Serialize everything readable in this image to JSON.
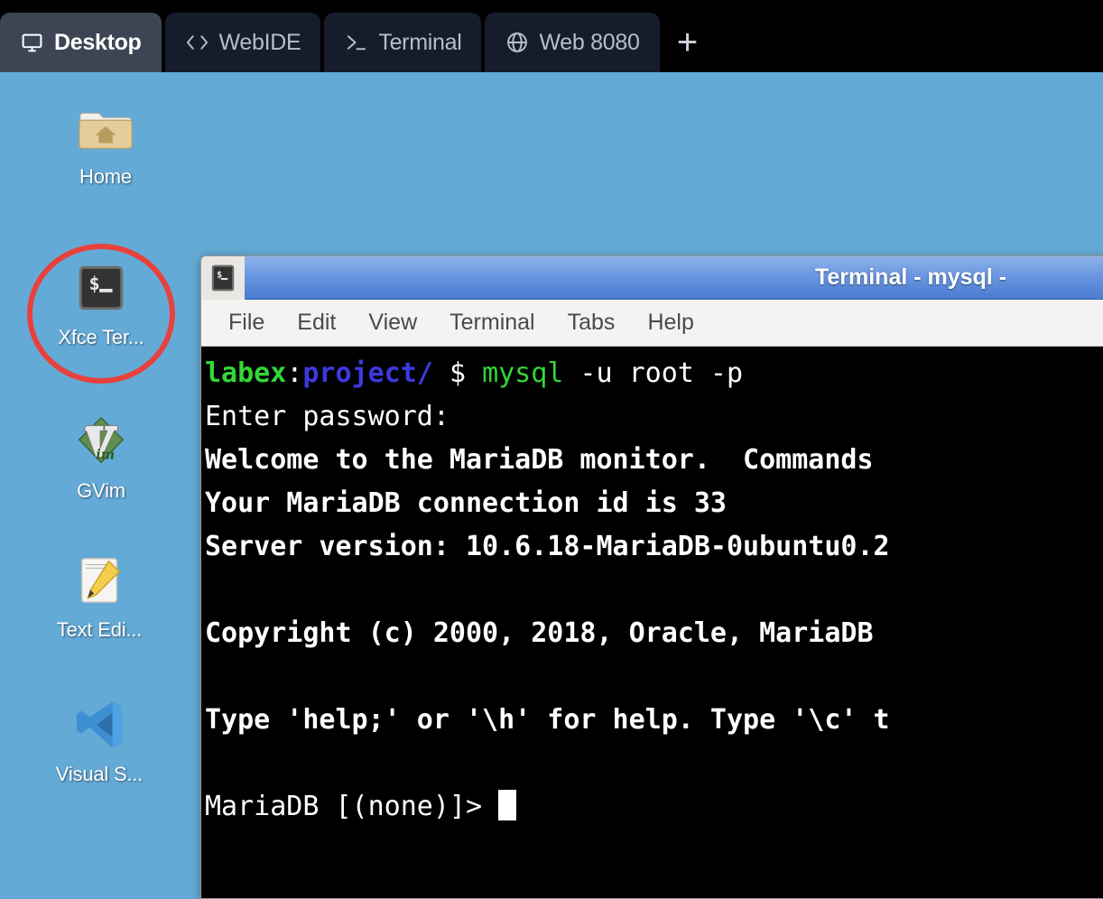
{
  "topbar": {
    "tabs": [
      {
        "label": "Desktop",
        "icon": "monitor-icon",
        "active": true
      },
      {
        "label": "WebIDE",
        "icon": "code-brackets-icon",
        "active": false
      },
      {
        "label": "Terminal",
        "icon": "prompt-icon",
        "active": false
      },
      {
        "label": "Web 8080",
        "icon": "globe-icon",
        "active": false
      }
    ],
    "add_tab_label": "+",
    "accent_strip_color": "#7bb8dd",
    "background_color": "#000000",
    "active_tab_color": "#3d4554",
    "inactive_tab_color": "#151c2c"
  },
  "desktop": {
    "background_color": "#64aad6",
    "icons": [
      {
        "label": "Home",
        "icon": "home-folder-icon"
      },
      {
        "label": "Xfce Ter...",
        "icon": "terminal-icon"
      },
      {
        "label": "GVim",
        "icon": "gvim-icon"
      },
      {
        "label": "Text Edi...",
        "icon": "text-editor-icon"
      },
      {
        "label": "Visual S...",
        "icon": "visual-studio-code-icon"
      }
    ],
    "annotation": {
      "shape": "ellipse",
      "color": "#e8413c",
      "targets": "Xfce Ter..."
    }
  },
  "terminal_window": {
    "title": "Terminal - mysql -",
    "title_icon": "terminal-icon",
    "menu": [
      "File",
      "Edit",
      "View",
      "Terminal",
      "Tabs",
      "Help"
    ],
    "background_color": "#000000",
    "prompt": {
      "user_host": "labex",
      "separator": ":",
      "path": "project/",
      "sigil": "$",
      "command": "mysql",
      "command_args": " -u root -p"
    },
    "lines": [
      "Enter password:",
      "Welcome to the MariaDB monitor.  Commands",
      "Your MariaDB connection id is 33",
      "Server version: 10.6.18-MariaDB-0ubuntu0.2",
      "",
      "Copyright (c) 2000, 2018, Oracle, MariaDB",
      "",
      "Type 'help;' or '\\h' for help. Type '\\c' t"
    ],
    "final_prompt": "MariaDB [(none)]> ",
    "cursor_visible": true
  }
}
